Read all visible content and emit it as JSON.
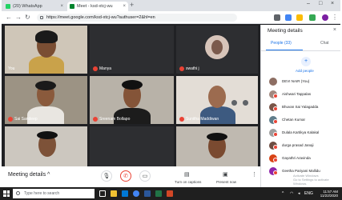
{
  "browser": {
    "tabs": [
      {
        "label": "(20) WhatsApp"
      },
      {
        "label": "Meet - ksd-xtcj-wu"
      }
    ],
    "new_tab": "+",
    "address": "https://meet.google.com/ksd-xtcj-wu?authuser=2&hl=en",
    "window_controls": [
      "–",
      "□",
      "×"
    ]
  },
  "meeting": {
    "participants_tiles": [
      {
        "name": "You"
      },
      {
        "name": "Manya"
      },
      {
        "name": "swathi j"
      },
      {
        "name": "Sai Sandeep"
      },
      {
        "name": "Sreenam Bollapo"
      },
      {
        "name": "Sunitha Maddiwan"
      },
      {
        "name": ""
      },
      {
        "name": ""
      },
      {
        "name": ""
      }
    ]
  },
  "controls": {
    "meeting_details": "Meeting details",
    "chevron": "^",
    "captions_label": "Turn on captions",
    "present_label": "Present now",
    "more": "⋮"
  },
  "panel": {
    "title": "Meeting details",
    "close": "×",
    "tab_people": "People (33)",
    "tab_chat": "Chat",
    "add_people": "Add people",
    "people": [
      {
        "name": "DEVI NAIR (You)",
        "color": "#8d6e63"
      },
      {
        "name": "Aishwari Tappalas",
        "color": "#a1887f"
      },
      {
        "name": "Bhuvan Sai Yalagadda",
        "color": "#795548"
      },
      {
        "name": "Chetan Kumar",
        "color": "#607d8b"
      },
      {
        "name": "Dulala Kartikya Kalakal",
        "color": "#9e9e9e"
      },
      {
        "name": "durga prasad Janaji",
        "color": "#6d4c41"
      },
      {
        "name": "Gayathri Aravinda",
        "color": "#d84315"
      },
      {
        "name": "Geetha Pariyani Mallidu",
        "color": "#8e24aa"
      }
    ],
    "watermark_line1": "Activate Windows",
    "watermark_line2": "Go to Settings to activate Windows."
  },
  "taskbar": {
    "search_placeholder": "Type here to search",
    "time": "11:57 AM",
    "date": "11/22/2020",
    "lang": "ENG"
  }
}
